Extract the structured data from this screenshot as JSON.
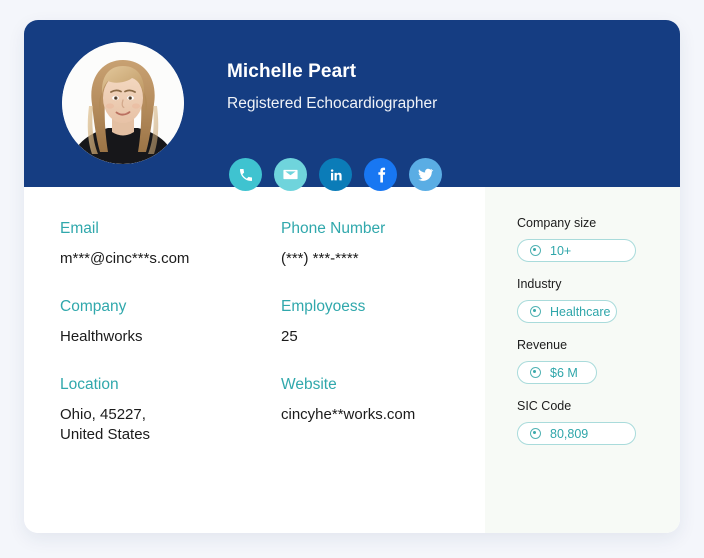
{
  "theme": {
    "page_background": "#f4f6fb",
    "card_background": "#ffffff",
    "header_background": "#153d82",
    "accent_teal": "#30a8ac",
    "sidebar_background": "#f7faf6",
    "badge_border": "#a9dbdb"
  },
  "header": {
    "name": "Michelle Peart",
    "job_title": "Registered Echocardiographer",
    "avatar_alt": "Michelle Peart profile photo",
    "social_links": [
      {
        "id": "phone",
        "icon": "phone-icon",
        "label": "Phone",
        "color": "#3fc3d0"
      },
      {
        "id": "email",
        "icon": "envelope-icon",
        "label": "Email",
        "color": "#6fd4dc"
      },
      {
        "id": "linkedin",
        "icon": "linkedin-icon",
        "label": "LinkedIn",
        "color": "#0b7cb8"
      },
      {
        "id": "facebook",
        "icon": "facebook-icon",
        "label": "Facebook",
        "color": "#1877f2"
      },
      {
        "id": "twitter",
        "icon": "twitter-icon",
        "label": "Twitter",
        "color": "#5aade4"
      }
    ]
  },
  "details": {
    "column_1": [
      {
        "label": "Email",
        "value": "m***@cinc***s.com"
      },
      {
        "label": "Company",
        "value": "Healthworks"
      },
      {
        "label": "Location",
        "value": "Ohio, 45227,\nUnited States"
      }
    ],
    "column_2": [
      {
        "label": "Phone Number",
        "value": "(***) ***-****"
      },
      {
        "label": "Employoess",
        "value": "25"
      },
      {
        "label": "Website",
        "value": "cincyhe**works.com"
      }
    ]
  },
  "sidebar": {
    "groups": [
      {
        "label": "Company size",
        "badge": "10+",
        "width": "wide"
      },
      {
        "label": "Industry",
        "badge": "Healthcare",
        "width": "medium"
      },
      {
        "label": "Revenue",
        "badge": "$6 M",
        "width": "narrow"
      },
      {
        "label": "SIC Code",
        "badge": "80,809",
        "width": "wide"
      }
    ]
  }
}
